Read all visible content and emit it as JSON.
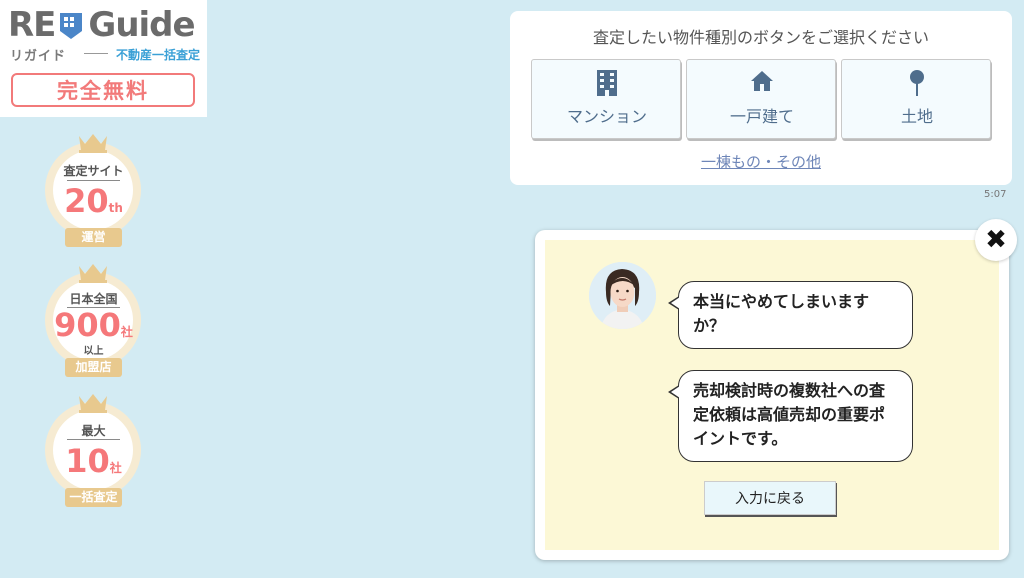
{
  "logo": {
    "brand_re": "RE",
    "brand_guide": "Guide",
    "kana": "リガイド",
    "subtitle": "不動産一括査定",
    "free_badge": "完全無料"
  },
  "medals": [
    {
      "top": "査定サイト",
      "number": "20",
      "unit": "th",
      "bottom": "運営"
    },
    {
      "top": "日本全国",
      "number": "900",
      "unit": "社",
      "note": "以上",
      "bottom": "加盟店"
    },
    {
      "top": "最大",
      "number": "10",
      "unit": "社",
      "bottom": "一括査定"
    }
  ],
  "selection": {
    "title": "査定したい物件種別のボタンをご選択ください",
    "buttons": [
      {
        "label": "マンション",
        "icon": "building-icon"
      },
      {
        "label": "一戸建て",
        "icon": "house-icon"
      },
      {
        "label": "土地",
        "icon": "pin-icon"
      }
    ],
    "other_link": "一棟もの・その他",
    "timestamp": "5:07"
  },
  "modal": {
    "close_symbol": "✖",
    "message1": "本当にやめてしまいますか？",
    "message2": "売却検討時の複数社への査定依頼は高値売却の重要ポイントです。",
    "back_button": "入力に戻る"
  },
  "colors": {
    "background": "#d3ebf3",
    "accent_pink": "#f27a7a",
    "brand_blue": "#3aa0d6",
    "medal_gold": "#e8c98e",
    "modal_bg": "#fcf8d6"
  }
}
